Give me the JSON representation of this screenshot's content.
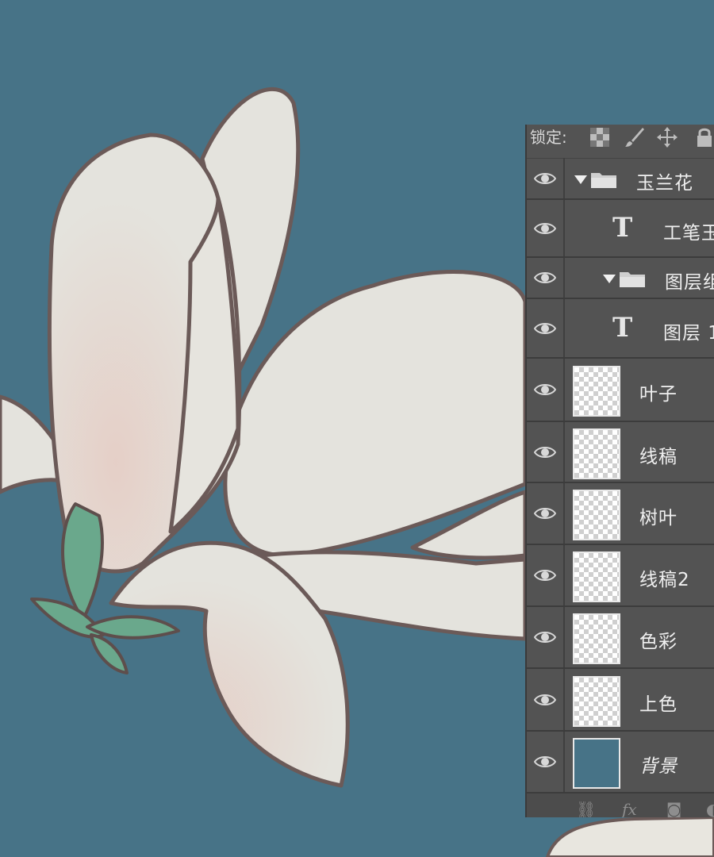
{
  "canvas": {
    "background_color": "#477387",
    "subject": "magnolia flower illustration",
    "petal_color": "#e3e3dd",
    "outline_color": "#6b5a58",
    "leaf_color": "#6aa88c"
  },
  "layers_panel": {
    "lock_label": "锁定:",
    "lock_icons": [
      "transparency-lock-icon",
      "brush-lock-icon",
      "move-lock-icon",
      "lock-icon"
    ],
    "layers": [
      {
        "name": "玉兰花",
        "kind": "group",
        "visible": true
      },
      {
        "name": "工笔玉",
        "kind": "text",
        "visible": true
      },
      {
        "name": "图层组",
        "kind": "group",
        "visible": true
      },
      {
        "name": "图层 1",
        "kind": "text",
        "visible": true
      },
      {
        "name": "叶子",
        "kind": "pixel",
        "visible": true
      },
      {
        "name": "线稿",
        "kind": "pixel",
        "visible": true
      },
      {
        "name": "树叶",
        "kind": "pixel",
        "visible": true
      },
      {
        "name": "线稿2",
        "kind": "pixel",
        "visible": true
      },
      {
        "name": "色彩",
        "kind": "pixel",
        "visible": true
      },
      {
        "name": "上色",
        "kind": "pixel",
        "visible": true
      },
      {
        "name": "背景",
        "kind": "background",
        "visible": true,
        "thumb_color": "#477387"
      }
    ],
    "bottom_icons": [
      "link-layers-icon",
      "fx-icon",
      "mask-icon",
      "adjustment-icon"
    ],
    "fx_label": "fx"
  }
}
